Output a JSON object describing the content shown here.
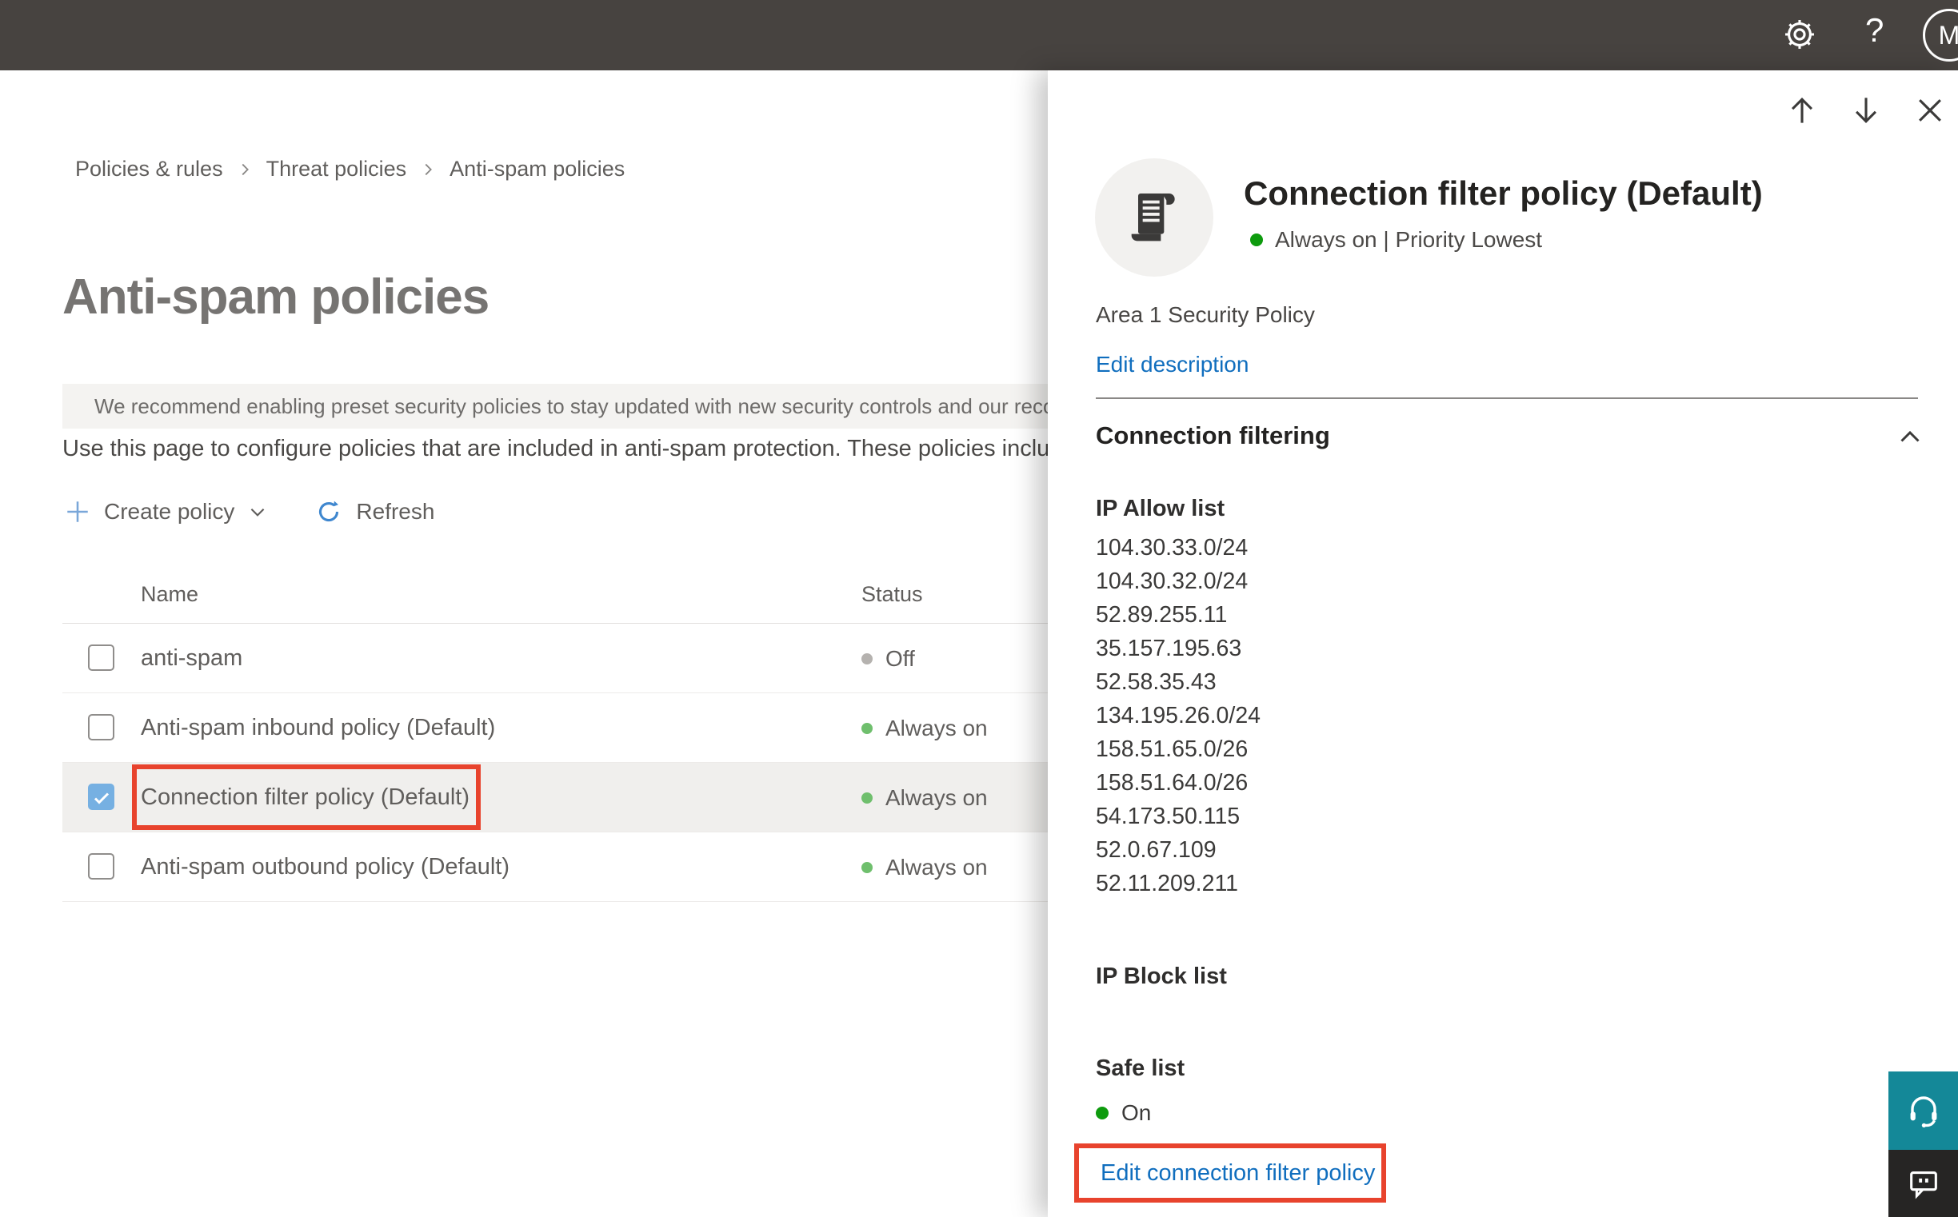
{
  "header": {
    "help_label": "?",
    "avatar_initial": "M"
  },
  "breadcrumb": {
    "items": [
      "Policies & rules",
      "Threat policies",
      "Anti-spam policies"
    ]
  },
  "page": {
    "title": "Anti-spam policies",
    "banner_text": "We recommend enabling preset security policies to stay updated with new security controls and our recomme",
    "description": "Use this page to configure policies that are included in anti-spam protection. These policies include",
    "toolbar": {
      "create_policy_label": "Create policy",
      "refresh_label": "Refresh"
    }
  },
  "table": {
    "columns": [
      "Name",
      "Status"
    ],
    "rows": [
      {
        "name": "anti-spam",
        "status": "Off",
        "dot": "#b5b2af",
        "checked": false,
        "selected": false
      },
      {
        "name": "Anti-spam inbound policy (Default)",
        "status": "Always on",
        "dot": "#6fbf6d",
        "checked": false,
        "selected": false
      },
      {
        "name": "Connection filter policy (Default)",
        "status": "Always on",
        "dot": "#6fbf6d",
        "checked": true,
        "selected": true
      },
      {
        "name": "Anti-spam outbound policy (Default)",
        "status": "Always on",
        "dot": "#6fbf6d",
        "checked": false,
        "selected": false
      }
    ]
  },
  "panel": {
    "title": "Connection filter policy (Default)",
    "status_line": "Always on | Priority Lowest",
    "status_dot": "#0e9b0e",
    "description": "Area 1 Security Policy",
    "edit_description_label": "Edit description",
    "section_title": "Connection filtering",
    "ip_allow_list_title": "IP Allow list",
    "ip_allow_list": [
      "104.30.33.0/24",
      "104.30.32.0/24",
      "52.89.255.11",
      "35.157.195.63",
      "52.58.35.43",
      "134.195.26.0/24",
      "158.51.65.0/26",
      "158.51.64.0/26",
      "54.173.50.115",
      "52.0.67.109",
      "52.11.209.211"
    ],
    "ip_block_list_title": "IP Block list",
    "safe_list_title": "Safe list",
    "safe_list_status": "On",
    "safe_list_dot": "#0e9b0e",
    "edit_link_label": "Edit connection filter policy"
  },
  "icons": {
    "settings": "gear",
    "help": "question-mark",
    "recommendation": "lightbulb",
    "create": "plus",
    "create_dropdown": "chevron-down",
    "refresh": "circular-arrow",
    "navigate_up": "arrow-up",
    "navigate_down": "arrow-down",
    "close": "x",
    "policy": "scroll",
    "collapse_section": "chevron-up",
    "support": "headset",
    "feedback": "chat-bubble"
  },
  "colors": {
    "topbar": "#474340",
    "accent_blue": "#106ebe",
    "annotation_red": "#e8432d",
    "status_green_soft": "#6fbf6d",
    "status_green": "#0e9b0e",
    "status_gray": "#b5b2af",
    "support_teal": "#148898",
    "selected_row": "#f0efed"
  }
}
